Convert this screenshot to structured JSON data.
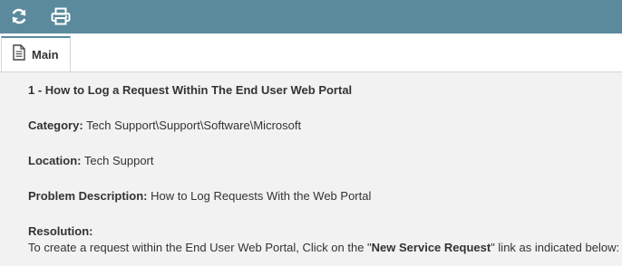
{
  "toolbar": {
    "refresh_icon": "refresh-icon",
    "print_icon": "print-icon",
    "background_color": "#5a8a9c"
  },
  "tabs": [
    {
      "label": "Main",
      "icon": "document-icon",
      "active": true
    }
  ],
  "article": {
    "title": "1 - How to Log a Request Within The End User Web Portal",
    "category_label": "Category:",
    "category_value": "Tech Support\\Support\\Software\\Microsoft",
    "location_label": "Location:",
    "location_value": "Tech Support",
    "problem_label": "Problem Description:",
    "problem_value": "How to Log Requests With the Web Portal",
    "resolution_label": "Resolution:",
    "resolution_text_before": "To create a request within the End User Web Portal, Click on the \"",
    "resolution_link": "New Service Request",
    "resolution_text_after": "\" link as indicated below:"
  }
}
